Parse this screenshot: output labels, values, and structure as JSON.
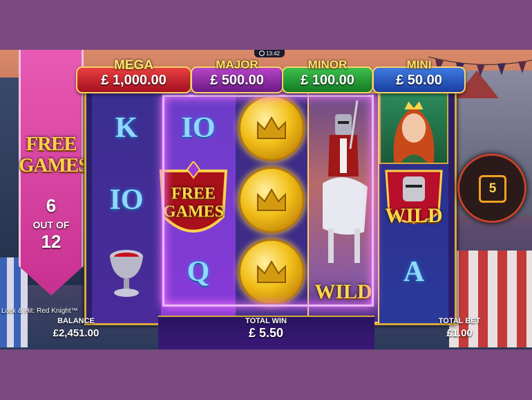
{
  "clock": "13:42",
  "jackpots": [
    {
      "name": "MEGA",
      "amount": "£ 1,000.00"
    },
    {
      "name": "MAJOR",
      "amount": "£ 500.00"
    },
    {
      "name": "MINOR",
      "amount": "£ 100.00"
    },
    {
      "name": "MINI",
      "amount": "£ 50.00"
    }
  ],
  "free_games": {
    "title_line1": "FREE",
    "title_line2": "GAMES",
    "current": "6",
    "out_of": "OUT OF",
    "total": "12"
  },
  "reels": {
    "r0": [
      "K",
      "IO",
      "goblet-icon"
    ],
    "r1": [
      "IO",
      "free-games-symbol",
      "Q"
    ],
    "r2": [
      "coin",
      "coin",
      "coin"
    ],
    "r3": [
      "knight-wild"
    ],
    "r4": [
      "lady-icon",
      "wild-shield",
      "A"
    ]
  },
  "symbols": {
    "k": "K",
    "io": "IO",
    "q": "Q",
    "a": "A",
    "wild": "WILD",
    "fg_line1": "FREE",
    "fg_line2": "GAMES"
  },
  "spin_counter": "5",
  "bottom": {
    "game_title": "Lock & Hit: Red Knight™",
    "balance_label": "BALANCE",
    "balance_value": "£2,451.00",
    "total_win_label": "TOTAL WIN",
    "total_win_value": "£ 5.50",
    "total_bet_label": "TOTAL BET",
    "total_bet_value": "£1.00"
  },
  "colors": {
    "outer_bg": "#7a4a7e",
    "banner_pink": "#e85ab4",
    "gold": "#ffd24a",
    "mega": "#e84040",
    "major": "#b844c8",
    "minor": "#3cc04c",
    "mini": "#3e7ae0"
  }
}
